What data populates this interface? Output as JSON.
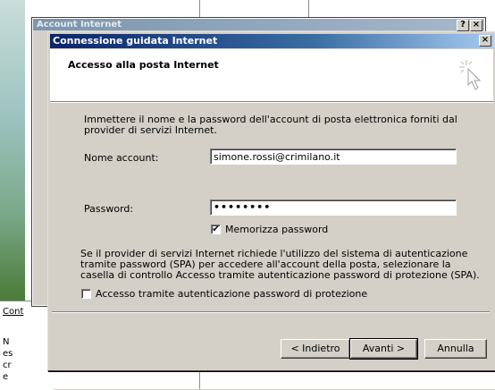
{
  "parent_dialog": {
    "title": "Account Internet",
    "help_label": "?",
    "close_label": "×"
  },
  "background": {
    "lower_label": "Cont",
    "lower_text": "Nes cre"
  },
  "wizard": {
    "title": "Connessione guidata Internet",
    "close_label": "×",
    "header_title": "Accesso alla posta Internet",
    "instructions": "Immettere il nome e la password dell'account di posta elettronica forniti dal provider di servizi Internet.",
    "account_label": "Nome account:",
    "account_value": "simone.rossi@crimilano.it",
    "password_label": "Password:",
    "password_value": "••••••••",
    "remember_label": "Memorizza password",
    "remember_checked": true,
    "spa_text": "Se il provider di servizi Internet richiede l'utilizzo del sistema di autenticazione tramite password (SPA) per accedere all'account della posta, selezionare la casella di controllo Accesso tramite autenticazione password di protezione (SPA).",
    "spa_label": "Accesso tramite autenticazione password di protezione",
    "spa_checked": false,
    "back_label": "< Indietro",
    "next_label": "Avanti >",
    "cancel_label": "Annulla"
  }
}
